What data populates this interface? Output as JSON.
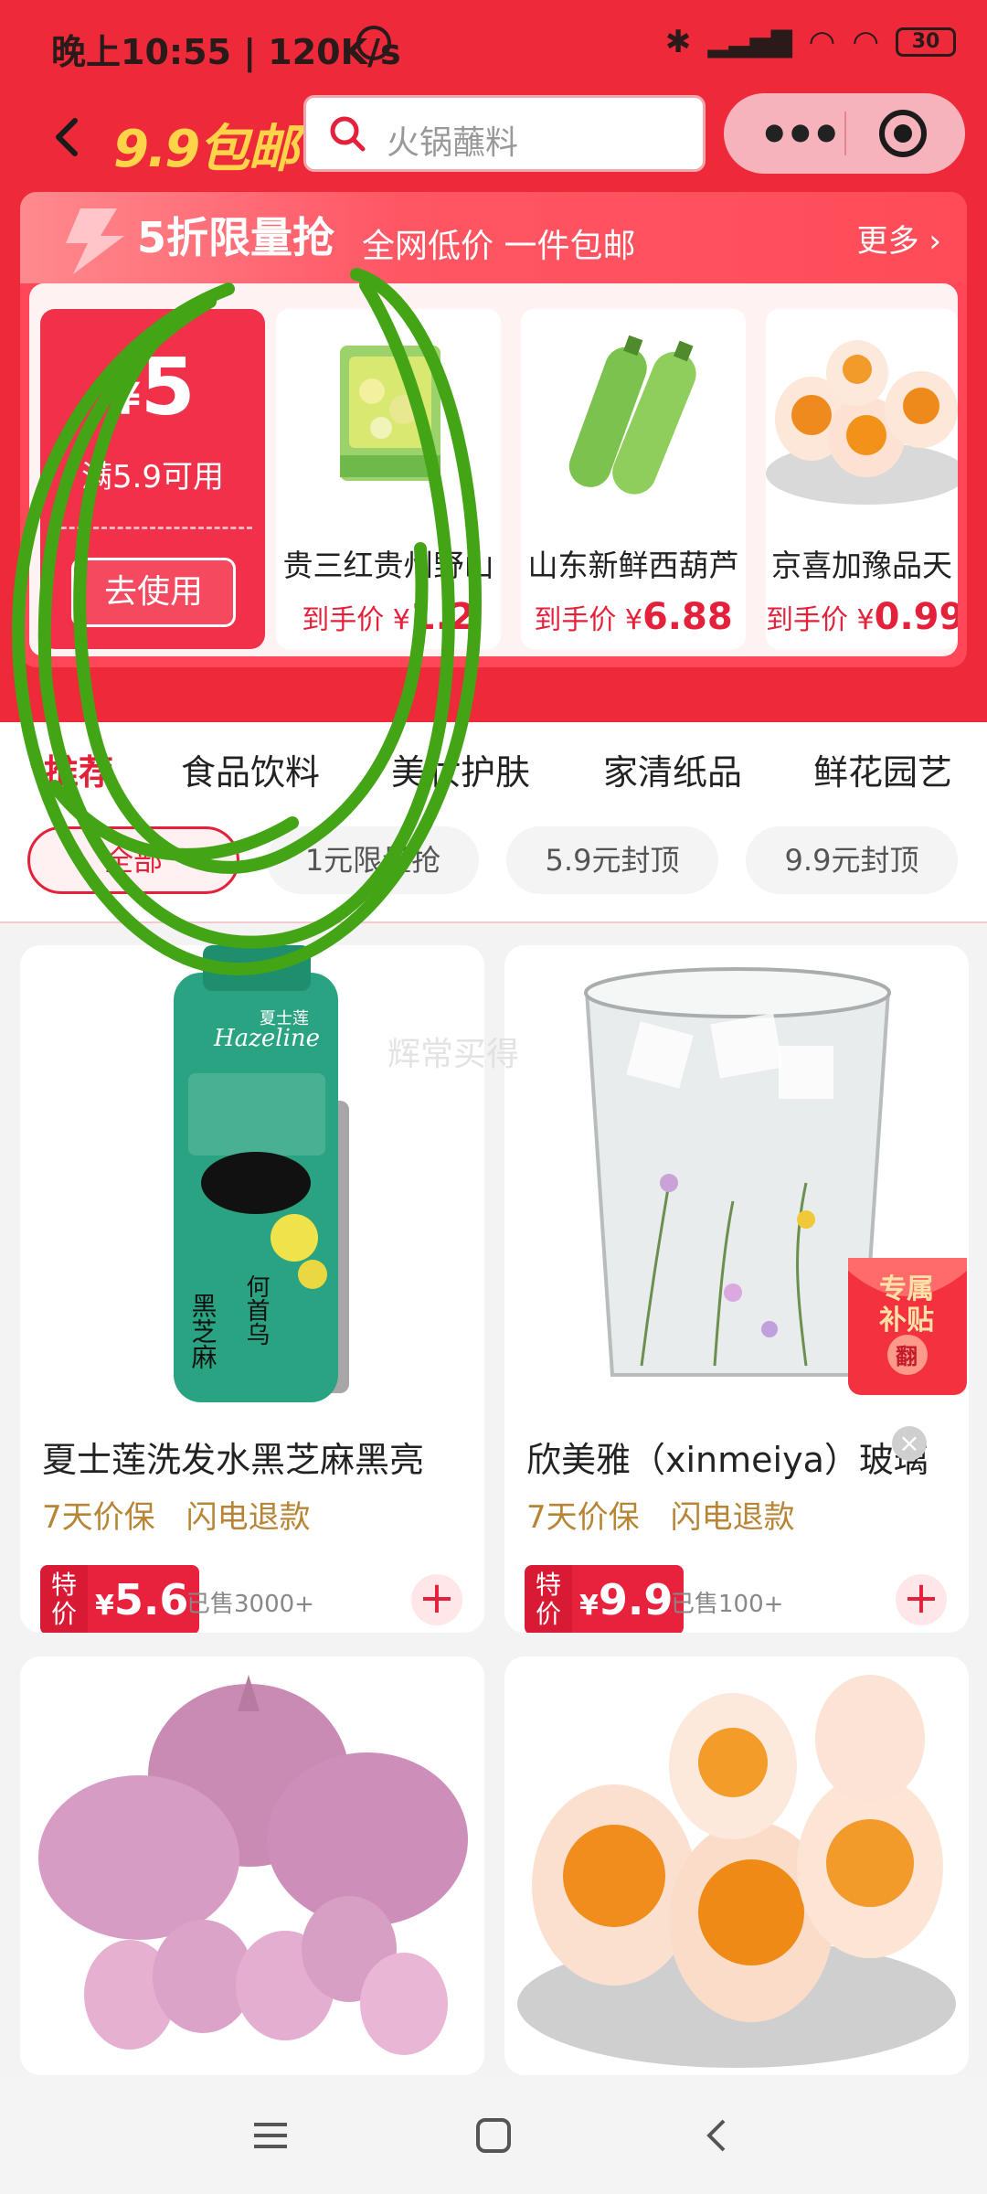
{
  "status_bar": {
    "time_text": "晚上10:55 | 120K/s",
    "battery": "30",
    "icons": [
      "alarm-icon",
      "bluetooth-icon",
      "signal-icon",
      "wifi-icon",
      "battery-icon"
    ]
  },
  "nav": {
    "brand": "9.9包邮",
    "search_placeholder": "火锅蘸料"
  },
  "promo": {
    "title": "5折限量抢",
    "subtitle": "全网低价 一件包邮",
    "more": "更多",
    "coupon": {
      "currency": "¥",
      "amount": "5",
      "condition": "满5.9可用",
      "button": "去使用"
    },
    "goods": [
      {
        "name": "贵三红贵州野山",
        "price_prefix": "到手价 ¥",
        "price": "1.2"
      },
      {
        "name": "山东新鲜西葫芦",
        "price_prefix": "到手价 ¥",
        "price": "6.88"
      },
      {
        "name": "京喜加豫品天",
        "price_prefix": "到手价 ¥",
        "price": "0.99"
      }
    ]
  },
  "tabs": [
    "推荐",
    "食品饮料",
    "美妆护肤",
    "家清纸品",
    "鲜花园艺"
  ],
  "filters": [
    "全部",
    "1元限量抢",
    "5.9元封顶",
    "9.9元封顶"
  ],
  "watermark": "辉常买得",
  "products": [
    {
      "title": "夏士莲洗发水黑芝麻黑亮",
      "tags": [
        "7天价保",
        "闪电退款"
      ],
      "label": "特价",
      "currency": "¥",
      "price": "5.6",
      "sold": "已售3000+"
    },
    {
      "title": "欣美雅（xinmeiya）玻璃",
      "tags": [
        "7天价保",
        "闪电退款"
      ],
      "label": "特价",
      "currency": "¥",
      "price": "9.9",
      "sold": "已售100+"
    },
    {
      "title": "",
      "tags": [],
      "label": "",
      "currency": "",
      "price": "",
      "sold": ""
    },
    {
      "title": "",
      "tags": [],
      "label": "",
      "currency": "",
      "price": "",
      "sold": ""
    }
  ],
  "subsidy_badge": {
    "line1": "专属",
    "line2": "补贴",
    "seal": "翻"
  },
  "product_images": {
    "p1_brand": "Hazeline",
    "p1_brand_cn": "夏士莲",
    "p1_text": "黑芝麻",
    "p1_text2": "何首乌"
  },
  "colors": {
    "brand_red": "#ee2a3a",
    "price_red": "#e4213a",
    "gold": "#ffd448",
    "annotation_green": "#43a416"
  }
}
